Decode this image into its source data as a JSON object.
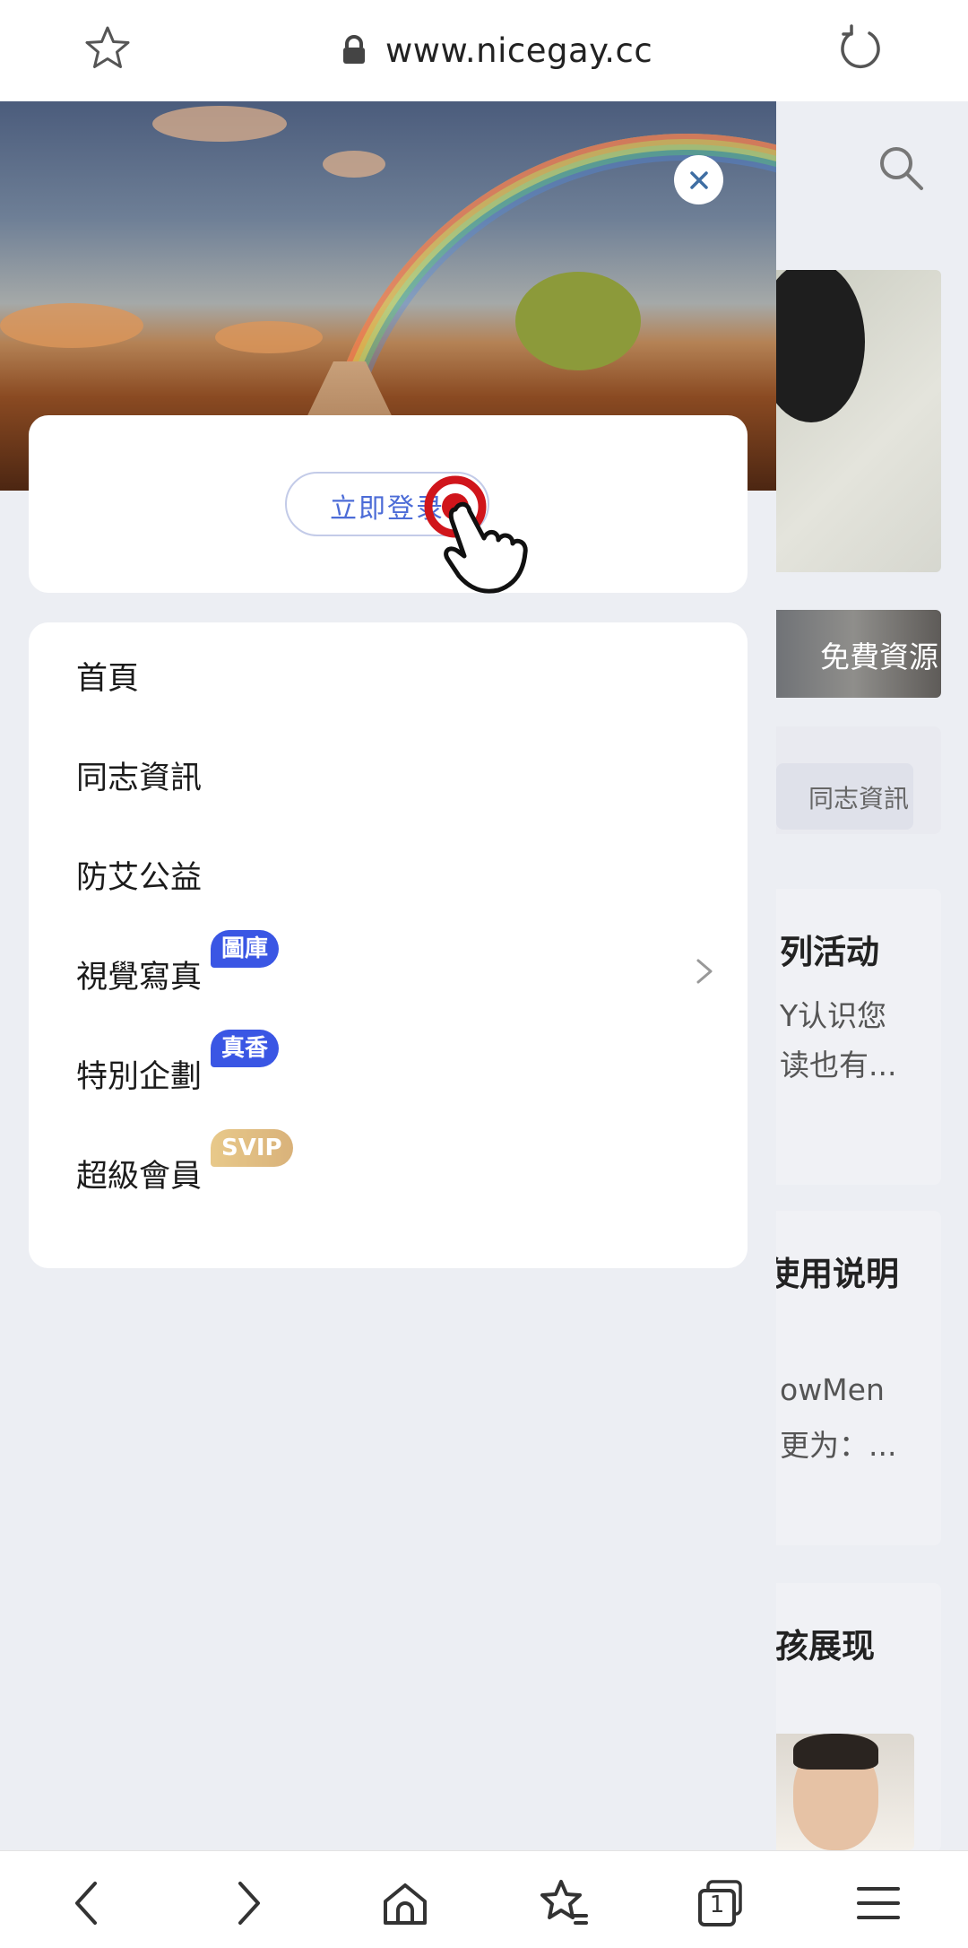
{
  "browser": {
    "url": "www.nicegay.cc",
    "tab_count": "1"
  },
  "background_page": {
    "banner_text": "免費資源",
    "chip_text": "同志資訊",
    "cards": [
      {
        "title": "列活动",
        "lines": [
          "Y认识您",
          "读也有..."
        ]
      },
      {
        "title": "使用说明",
        "lines": [
          "owMen",
          "更为：..."
        ]
      },
      {
        "title": "孩展现",
        "lines": []
      }
    ]
  },
  "drawer": {
    "login_label": "立即登录",
    "menu": [
      {
        "label": "首頁",
        "badge": ""
      },
      {
        "label": "同志資訊",
        "badge": ""
      },
      {
        "label": "防艾公益",
        "badge": ""
      },
      {
        "label": "視覺寫真",
        "badge": "圖庫",
        "has_chevron": true
      },
      {
        "label": "特別企劃",
        "badge": "真香"
      },
      {
        "label": "超級會員",
        "badge": "SVIP"
      }
    ]
  },
  "colors": {
    "accent_blue": "#3a56e4",
    "login_text": "#4c6cd7",
    "svip_gold": "#e3c184",
    "tap_red": "#d0151b"
  },
  "icons": [
    "star-icon",
    "lock-icon",
    "reload-icon",
    "search-icon",
    "close-icon",
    "tap-hand-icon",
    "chevron-right-icon",
    "back-icon",
    "forward-icon",
    "home-icon",
    "bookmarks-icon",
    "tabs-icon",
    "menu-icon"
  ]
}
